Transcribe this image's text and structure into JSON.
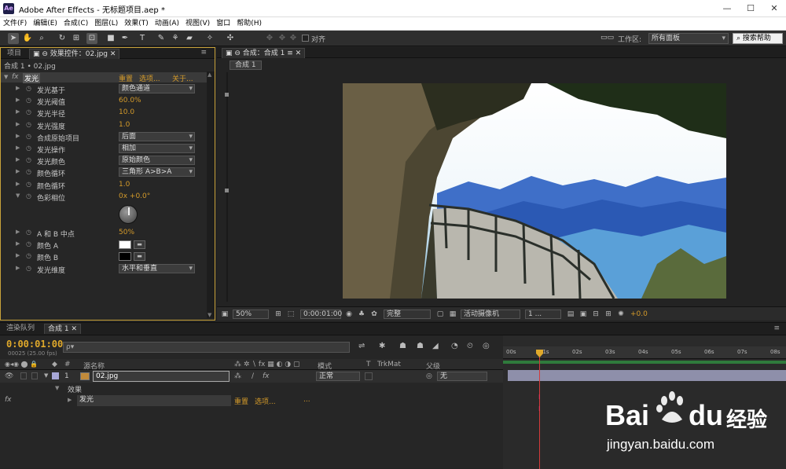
{
  "window": {
    "title": "Adobe After Effects - 无标题项目.aep *",
    "logo": "Ae"
  },
  "menu": [
    "文件(F)",
    "编辑(E)",
    "合成(C)",
    "图层(L)",
    "效果(T)",
    "动画(A)",
    "视图(V)",
    "窗口",
    "帮助(H)"
  ],
  "toolbar": {
    "snap_label": "对齐",
    "workspace_label": "工作区:",
    "workspace_value": "所有面板",
    "search_help": "搜索帮助"
  },
  "left_panel": {
    "tabs": [
      "项目",
      "效果控件：02.jpg"
    ],
    "subtitle": "合成 1 • 02.jpg",
    "effect_name": "发光",
    "effect_links": {
      "reset": "重置",
      "options": "选项...",
      "about": "关于..."
    },
    "properties": [
      {
        "label": "发光基于",
        "kind": "dropdown",
        "value": "颜色通道"
      },
      {
        "label": "发光阈值",
        "kind": "value",
        "value": "60.0%"
      },
      {
        "label": "发光半径",
        "kind": "value",
        "value": "10.0"
      },
      {
        "label": "发光强度",
        "kind": "value",
        "value": "1.0"
      },
      {
        "label": "合成原始项目",
        "kind": "dropdown",
        "value": "后面"
      },
      {
        "label": "发光操作",
        "kind": "dropdown",
        "value": "相加"
      },
      {
        "label": "发光颜色",
        "kind": "dropdown",
        "value": "原始颜色"
      },
      {
        "label": "颜色循环",
        "kind": "dropdown",
        "value": "三角形 A>B>A"
      },
      {
        "label": "颜色循环",
        "kind": "value",
        "value": "1.0"
      },
      {
        "label": "色彩相位",
        "kind": "value",
        "value": "0x +0.0°"
      }
    ],
    "properties2": [
      {
        "label": "A 和 B 中点",
        "kind": "value",
        "value": "50%"
      },
      {
        "label": "颜色 A",
        "kind": "swatch",
        "color": "#ffffff"
      },
      {
        "label": "颜色 B",
        "kind": "swatch",
        "color": "#000000"
      },
      {
        "label": "发光维度",
        "kind": "dropdown",
        "value": "水平和垂直"
      }
    ]
  },
  "comp_panel": {
    "tab": "合成：合成 1",
    "subtab": "合成 1",
    "zoom": "50%",
    "timecode": "0:00:01:00",
    "quality": "完整",
    "camera": "活动摄像机",
    "views": "1 ...",
    "exposure": "+0.0"
  },
  "timeline": {
    "tabs": [
      "渲染队列",
      "合成 1"
    ],
    "timecode": "0:00:01:00",
    "fps_label": "00025 (25.00 fps)",
    "search_placeholder": "ρ▾",
    "headers": {
      "source": "源名称",
      "mode": "模式",
      "t": "T",
      "trkmat": "TrkMat",
      "parent": "父级"
    },
    "layer": {
      "index": "1",
      "name": "02.jpg",
      "mode": "正常",
      "parent": "无"
    },
    "effects_label": "效果",
    "glow": {
      "name": "发光",
      "reset": "重置",
      "options": "选项...",
      "more": "..."
    },
    "ticks": [
      "00s",
      "01s",
      "02s",
      "03s",
      "04s",
      "05s",
      "06s",
      "07s",
      "08s"
    ]
  },
  "watermark": {
    "brand": "Bai",
    "brand2": "du",
    "cn": "经验",
    "url": "jingyan.baidu.com"
  }
}
